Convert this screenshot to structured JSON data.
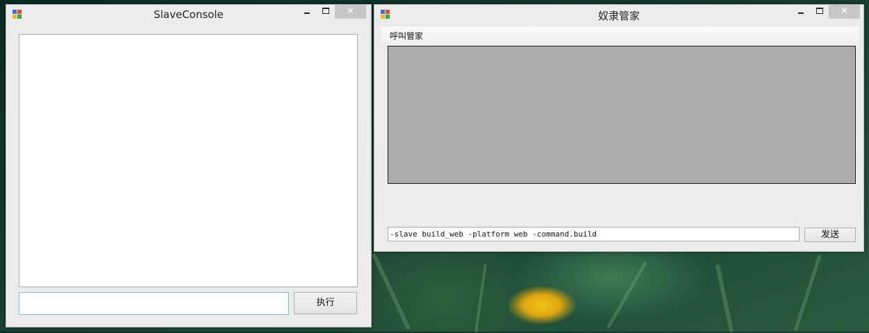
{
  "windows": {
    "slave_console": {
      "title": "SlaveConsole",
      "input": {
        "value": "",
        "placeholder": ""
      },
      "execute_label": "执行",
      "close_glyph": "✕"
    },
    "slave_manager": {
      "title": "奴隶管家",
      "menu": {
        "call_manager": "呼叫管家"
      },
      "command_value": "-slave build_web -platform web -command.build",
      "send_label": "发送",
      "close_glyph": "✕"
    }
  },
  "icons": [
    "app-icon",
    "minimize-icon",
    "maximize-icon",
    "close-icon"
  ],
  "colors": {
    "window_bg": "#ececec",
    "close_button": "#c7c7c7",
    "display_panel": "#acacac",
    "input_focus_border": "#7eb4ea"
  }
}
